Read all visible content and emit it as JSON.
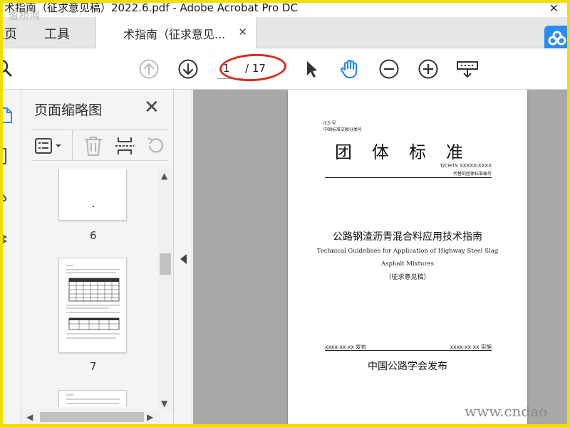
{
  "window": {
    "title": "术指南（征求意见稿）2022.6.pdf - Adobe Acrobat Pro DC",
    "close_glyph": "✕"
  },
  "watermarks": {
    "top": "道桥网",
    "bottom": "www.cndao"
  },
  "tabs": {
    "home": "主页",
    "tools": "工具",
    "document": "术指南（征求意见...",
    "document_close": "✕"
  },
  "toolbar": {
    "current_page": "1",
    "page_count": "/ 17",
    "accent": "#2a8bf2",
    "highlight": "#e1281c"
  },
  "thumbnail_panel": {
    "title": "页面缩略图",
    "close": "✕",
    "thumbnails": [
      {
        "number": "6"
      },
      {
        "number": "7"
      }
    ]
  },
  "document": {
    "ics": "ICS 号",
    "classification": "中国标准文献分类号",
    "heading": "团体标准",
    "code": "T/CHTS XXXXX-XXXX",
    "code_note": "代替的团体标准编号",
    "title_cn": "公路钢渣沥青混合料应用技术指南",
    "title_en_1": "Technical Guidelines for Application of Highway Steel Slag",
    "title_en_2": "Asphalt Mixtures",
    "draft": "（征求意见稿）",
    "issue_date": "xxxx-xx-xx 发布",
    "effective_date": "xxxx-xx-xx 实施",
    "publisher": "中国公路学会发布"
  }
}
